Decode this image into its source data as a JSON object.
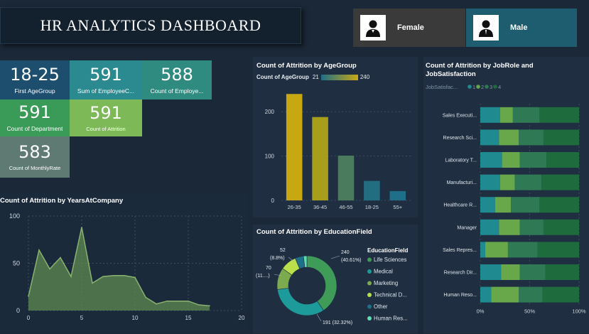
{
  "title": "HR ANALYTICS DASHBOARD",
  "slicers": [
    {
      "label": "Female"
    },
    {
      "label": "Male"
    }
  ],
  "kpis": {
    "first_agegroup": {
      "value": "18-25",
      "label": "First AgeGroup"
    },
    "sum_employee": {
      "value": "591",
      "label": "Sum of EmployeeC..."
    },
    "count_employee": {
      "value": "588",
      "label": "Count of Employe..."
    },
    "count_department": {
      "value": "591",
      "label": "Count of Department"
    },
    "count_attrition": {
      "value": "591",
      "label": "Count of Attrition"
    },
    "count_monthlyrate": {
      "value": "583",
      "label": "Count of MonthlyRate"
    }
  },
  "colors": {
    "bg": "#1b2838",
    "panel": "#1f2e40",
    "kpi_blue": "#1d4e6e",
    "kpi_teal": "#2a8a8f",
    "kpi_teal2": "#2f8a80",
    "kpi_green": "#3a9a58",
    "kpi_lime": "#7dba57",
    "kpi_gray": "#5f7a73",
    "female_bg": "#3a3a3a",
    "male_bg": "#1e5c70"
  },
  "chart_data": [
    {
      "id": "years",
      "type": "area",
      "title": "Count of Attrition by YearsAtCompany",
      "x": [
        0,
        1,
        2,
        3,
        4,
        5,
        6,
        7,
        8,
        9,
        10,
        11,
        12,
        13,
        14,
        15,
        16,
        17
      ],
      "values": [
        15,
        64,
        44,
        56,
        36,
        88,
        29,
        36,
        37,
        37,
        35,
        14,
        7,
        10,
        10,
        10,
        6,
        5
      ],
      "xticks": [
        "0",
        "5",
        "10",
        "15",
        "20"
      ],
      "yticks": [
        "0",
        "50",
        "100"
      ],
      "xlim": [
        0,
        20
      ],
      "ylim": [
        0,
        100
      ],
      "color": "#5f8a52"
    },
    {
      "id": "age",
      "type": "bar",
      "title": "Count of Attrition by AgeGroup",
      "legend_label": "Count of AgeGroup",
      "legend_min": "21",
      "legend_max": "240",
      "categories": [
        "26-35",
        "36-45",
        "46-55",
        "18-25",
        "55+"
      ],
      "values": [
        240,
        188,
        101,
        44,
        21
      ],
      "yticks": [
        "0",
        "100",
        "200"
      ],
      "ylim": [
        0,
        250
      ],
      "colors": [
        "#c8a812",
        "#a79e1c",
        "#4a7b5c",
        "#226e80",
        "#1f6f88"
      ]
    },
    {
      "id": "edu",
      "type": "pie",
      "title": "Count of Attrition by EducationField",
      "legend_title": "EducationField",
      "categories": [
        "Life Sciences",
        "Medical",
        "Marketing",
        "Technical D...",
        "Other",
        "Human Res..."
      ],
      "values": [
        240,
        191,
        70,
        52,
        27,
        11
      ],
      "colors": [
        "#3f9b58",
        "#1d9a9a",
        "#7bab4e",
        "#b9e04a",
        "#1f6f88",
        "#5fdcb4"
      ],
      "labels": [
        {
          "a": "240",
          "b": "(40.61%)"
        },
        {
          "a": "191 (32.32%)"
        },
        {
          "a": "70",
          "b": "(11....)"
        },
        {
          "a": "52",
          "b": "(8.8%)"
        }
      ]
    },
    {
      "id": "jobrole",
      "type": "bar",
      "title": "Count of Attrition by JobRole and",
      "title2": "JobSatisfaction",
      "legend_title": "JobSatisfac...",
      "series_names": [
        "1",
        "2",
        "3",
        "4"
      ],
      "categories": [
        "Sales Executi...",
        "Research Sci...",
        "Laboratory T...",
        "Manufacturi...",
        "Healthcare R...",
        "Manager",
        "Sales Repres...",
        "Research Dir...",
        "Human Reso..."
      ],
      "series": [
        {
          "name": "1",
          "values": [
            20,
            19,
            22,
            20,
            15,
            19,
            5,
            21,
            11
          ]
        },
        {
          "name": "2",
          "values": [
            13,
            20,
            18,
            15,
            16,
            21,
            23,
            19,
            28
          ]
        },
        {
          "name": "3",
          "values": [
            27,
            25,
            27,
            27,
            29,
            24,
            30,
            26,
            24
          ]
        },
        {
          "name": "4",
          "values": [
            40,
            36,
            33,
            38,
            40,
            36,
            42,
            34,
            37
          ]
        }
      ],
      "xticks": [
        "0%",
        "50%",
        "100%"
      ],
      "colors": [
        "#1f8a8f",
        "#68a84a",
        "#2f7a55",
        "#1e6b3e"
      ]
    }
  ]
}
